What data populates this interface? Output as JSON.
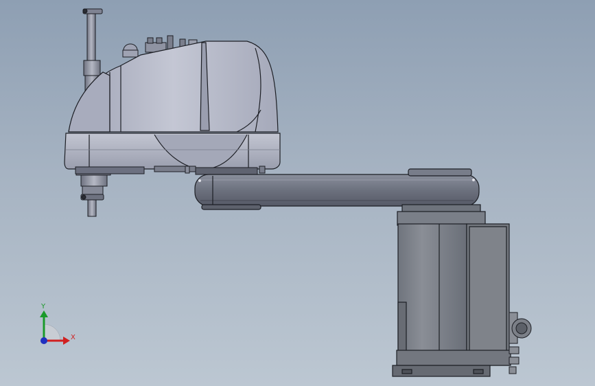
{
  "viewport": {
    "background_top": "#8e9fb3",
    "background_bottom": "#bcc7d2"
  },
  "robot": {
    "body_color": "#b8bccb",
    "body_shadow": "#8f93a6",
    "arm_color": "#6f7481",
    "base_color": "#7a7f88",
    "outline_color": "#1c1e24"
  },
  "triad": {
    "x_label": "X",
    "y_label": "Y",
    "x_color": "#d02020",
    "y_color": "#1a9a2a",
    "z_color": "#2030c0"
  }
}
